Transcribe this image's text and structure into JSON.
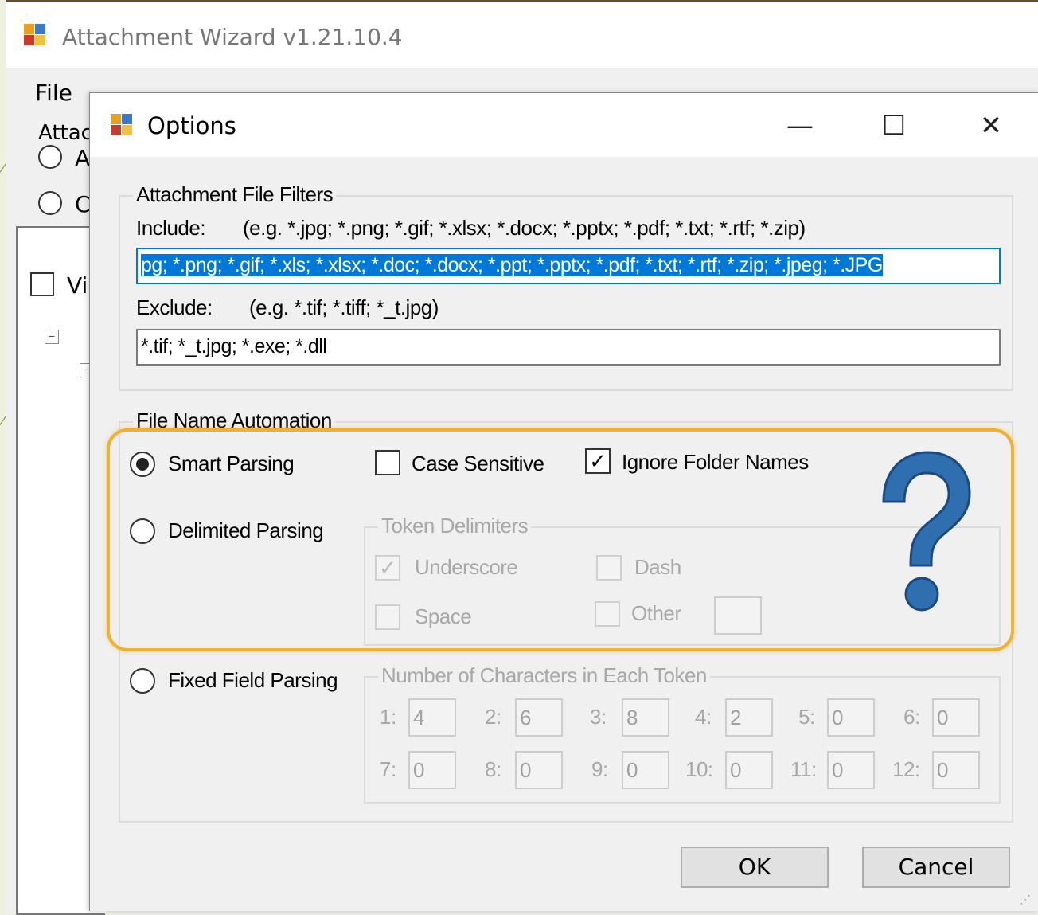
{
  "main_window": {
    "title": "Attachment Wizard v1.21.10.4",
    "menu_file": "File",
    "group_label_partial": "Attac",
    "radio_a_partial": "A",
    "radio_c_partial": "C",
    "check_partial": "Vi"
  },
  "dialog": {
    "title": "Options",
    "minimize": "—",
    "maximize": "☐",
    "close": "✕",
    "filters": {
      "group_label": "Attachment File Filters",
      "include_label": "Include:",
      "include_example": "(e.g. *.jpg; *.png; *.gif; *.xlsx; *.docx; *.pptx; *.pdf; *.txt; *.rtf; *.zip)",
      "include_value": "pg; *.png; *.gif; *.xls; *.xlsx; *.doc; *.docx; *.ppt; *.pptx; *.pdf; *.txt; *.rtf; *.zip; *.jpeg; *.JPG",
      "exclude_label": "Exclude:",
      "exclude_example": "(e.g. *.tif; *.tiff; *_t.jpg)",
      "exclude_value": "*.tif; *_t.jpg; *.exe; *.dll"
    },
    "automation": {
      "group_label": "File Name Automation",
      "smart_parsing": "Smart Parsing",
      "case_sensitive": "Case Sensitive",
      "ignore_folder_names": "Ignore Folder Names",
      "delimited_parsing": "Delimited Parsing",
      "token_delimiters_label": "Token Delimiters",
      "underscore": "Underscore",
      "dash": "Dash",
      "space": "Space",
      "other": "Other",
      "fixed_field_parsing": "Fixed Field Parsing",
      "num_chars_label": "Number of Characters in Each Token",
      "tokens": [
        {
          "label": "1:",
          "value": "4"
        },
        {
          "label": "2:",
          "value": "6"
        },
        {
          "label": "3:",
          "value": "8"
        },
        {
          "label": "4:",
          "value": "2"
        },
        {
          "label": "5:",
          "value": "0"
        },
        {
          "label": "6:",
          "value": "0"
        },
        {
          "label": "7:",
          "value": "0"
        },
        {
          "label": "8:",
          "value": "0"
        },
        {
          "label": "9:",
          "value": "0"
        },
        {
          "label": "10:",
          "value": "0"
        },
        {
          "label": "11:",
          "value": "0"
        },
        {
          "label": "12:",
          "value": "0"
        }
      ]
    },
    "ok_label": "OK",
    "cancel_label": "Cancel"
  },
  "overlay": {
    "question_icon": "question-mark-icon",
    "highlight_color": "#f0b030",
    "question_color": "#2f6fb0"
  }
}
